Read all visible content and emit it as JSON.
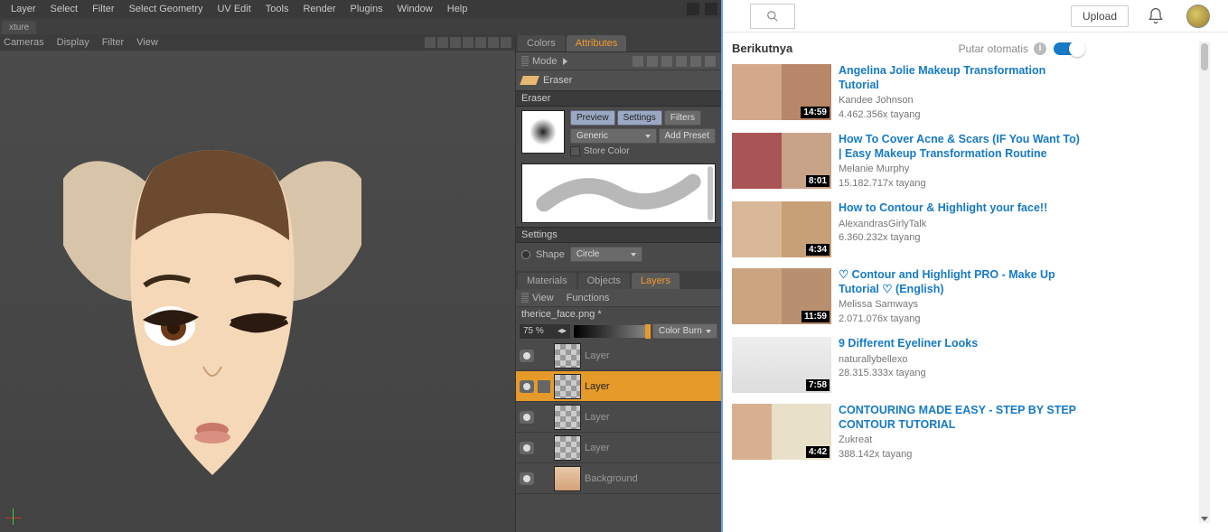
{
  "app": {
    "menus": [
      "Layer",
      "Select",
      "Filter",
      "Select Geometry",
      "UV Edit",
      "Tools",
      "Render",
      "Plugins",
      "Window",
      "Help"
    ],
    "doc_tab": "xture",
    "vp_menus": [
      "Cameras",
      "Display",
      "Filter",
      "View"
    ],
    "side_tabs": {
      "colors": "Colors",
      "attributes": "Attributes"
    },
    "mode_label": "Mode",
    "tool_name": "Eraser",
    "eraser_head": "Eraser",
    "eraser": {
      "preview": "Preview",
      "settings": "Settings",
      "filters": "Filters",
      "generic": "Generic",
      "add_preset": "Add Preset",
      "store_color": "Store Color"
    },
    "settings_head": "Settings",
    "settings": {
      "shape": "Shape",
      "circle": "Circle"
    },
    "mat_tabs": {
      "materials": "Materials",
      "objects": "Objects",
      "layers": "Layers"
    },
    "layer_row": {
      "view": "View",
      "functions": "Functions"
    },
    "filename": "therice_face.png *",
    "opacity": "75 %",
    "blend": "Color Burn",
    "layers": [
      {
        "name": "Layer",
        "sel": false,
        "brush": false,
        "bg": false
      },
      {
        "name": "Layer",
        "sel": true,
        "brush": true,
        "bg": false
      },
      {
        "name": "Layer",
        "sel": false,
        "brush": false,
        "bg": false
      },
      {
        "name": "Layer",
        "sel": false,
        "brush": false,
        "bg": false
      },
      {
        "name": "Background",
        "sel": false,
        "brush": false,
        "bg": true
      }
    ]
  },
  "yt": {
    "upload": "Upload",
    "next": "Berikutnya",
    "autoplay": "Putar otomatis",
    "videos": [
      {
        "title": "Angelina Jolie Makeup Transformation Tutorial",
        "channel": "Kandee Johnson",
        "views": "4.462.356x tayang",
        "dur": "14:59",
        "cls": "t1"
      },
      {
        "title": "How To Cover Acne & Scars (IF You Want To) | Easy Makeup Transformation Routine",
        "channel": "Melanie Murphy",
        "views": "15.182.717x tayang",
        "dur": "8:01",
        "cls": "t2"
      },
      {
        "title": "How to Contour & Highlight your face!!",
        "channel": "AlexandrasGirlyTalk",
        "views": "6.360.232x tayang",
        "dur": "4:34",
        "cls": "t3"
      },
      {
        "title": "♡ Contour and Highlight PRO - Make Up Tutorial ♡ (English)",
        "channel": "Melissa Samways",
        "views": "2.071.076x tayang",
        "dur": "11:59",
        "cls": "t4"
      },
      {
        "title": "9 Different Eyeliner Looks",
        "channel": "naturallybellexo",
        "views": "28.315.333x tayang",
        "dur": "7:58",
        "cls": "t5"
      },
      {
        "title": "CONTOURING MADE EASY - STEP BY STEP CONTOUR TUTORIAL",
        "channel": "Zukreat",
        "views": "388.142x tayang",
        "dur": "4:42",
        "cls": "t6"
      }
    ]
  }
}
